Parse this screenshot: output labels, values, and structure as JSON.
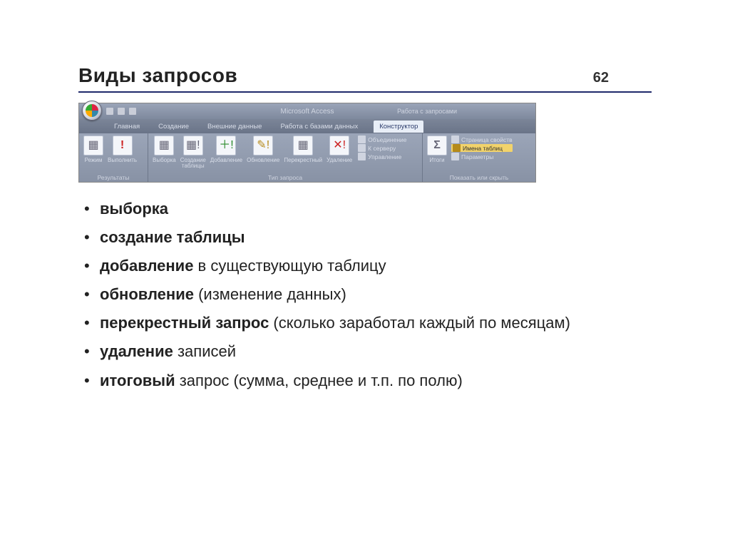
{
  "header": {
    "title": "Виды запросов",
    "page": "62"
  },
  "ribbon": {
    "app_title": "Microsoft Access",
    "context_title": "Работа с запросами",
    "tabs": {
      "home": "Главная",
      "create": "Создание",
      "external": "Внешние данные",
      "dbtools": "Работа с базами данных",
      "active": "Конструктор"
    },
    "groups": {
      "results": {
        "mode": "Режим",
        "run": "Выполнить",
        "label": "Результаты"
      },
      "querytype": {
        "select": "Выборка",
        "maketable": "Создание\nтаблицы",
        "append": "Добавление",
        "update": "Обновление",
        "crosstab": "Перекрестный",
        "delete": "Удаление",
        "label": "Тип запроса",
        "extra": {
          "union": "Объединение",
          "server": "К серверу",
          "control": "Управление"
        }
      },
      "totals": {
        "totals": "Итоги",
        "propsheet": "Страница свойств",
        "tablenames": "Имена таблиц",
        "params": "Параметры",
        "label": "Показать или скрыть"
      }
    }
  },
  "bullets": {
    "b1_bold": "выборка",
    "b2_bold": "создание таблицы",
    "b3_bold": "добавление",
    "b3_rest": " в существующую таблицу",
    "b4_bold": "обновление",
    "b4_rest": " (изменение данных)",
    "b5_bold": "перекрестный запрос",
    "b5_rest": " (сколько заработал каждый по месяцам)",
    "b6_bold": "удаление",
    "b6_rest": " записей",
    "b7_bold": "итоговый",
    "b7_rest": " запрос (сумма, среднее и т.п. по полю)"
  }
}
